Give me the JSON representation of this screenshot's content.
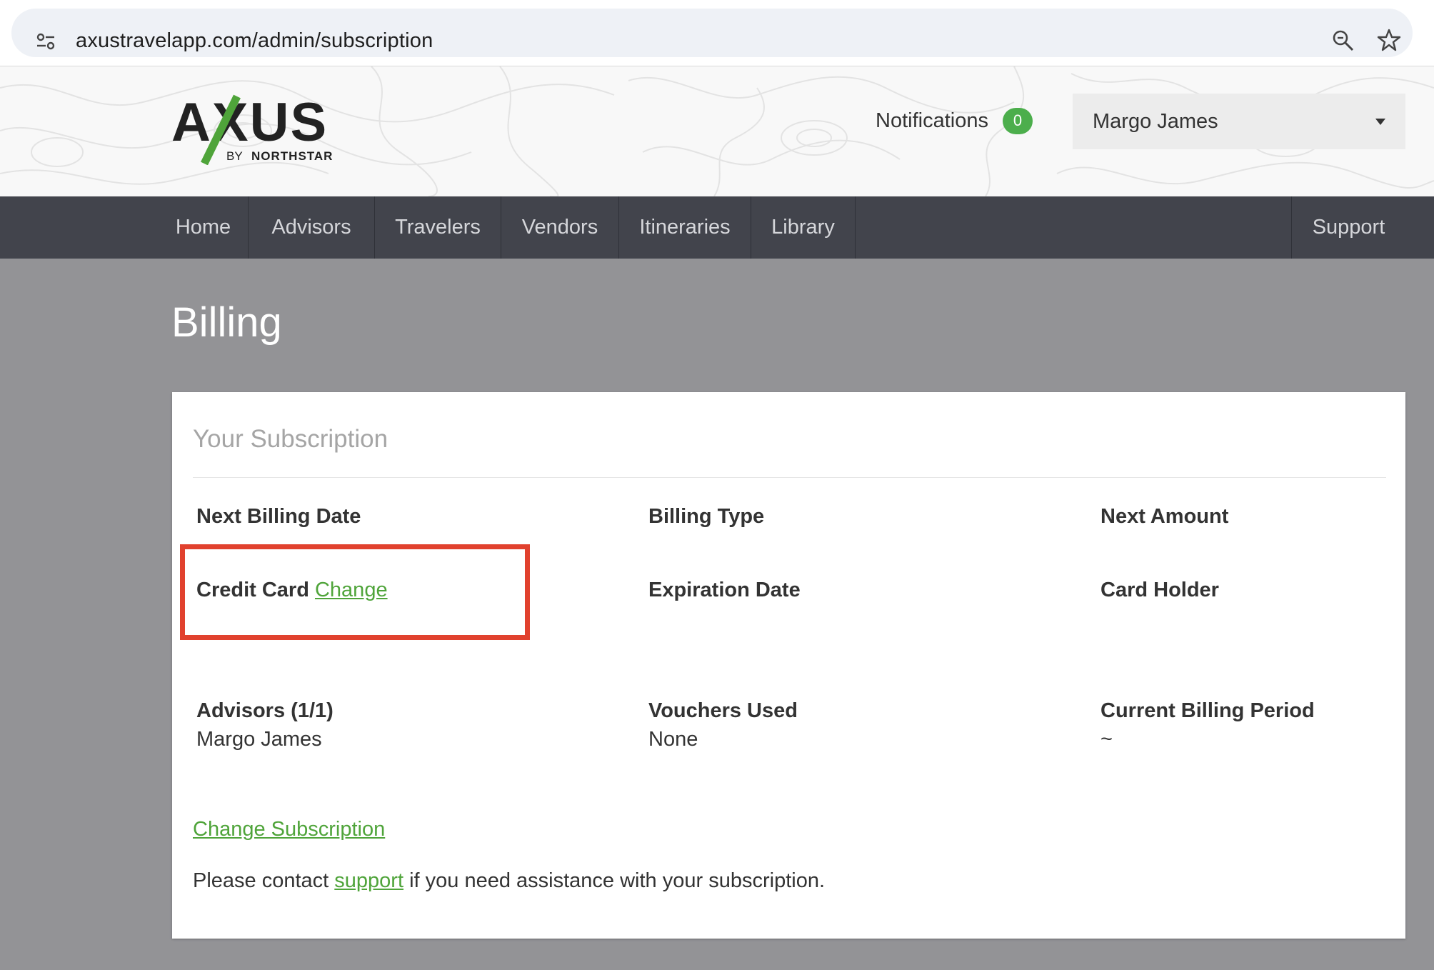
{
  "browser": {
    "url": "axustravelapp.com/admin/subscription"
  },
  "header": {
    "logo_text": "AXUS",
    "logo_sub_by": "BY",
    "logo_sub_brand": "NORTHSTAR",
    "notifications_label": "Notifications",
    "notifications_count": "0",
    "user_name": "Margo James"
  },
  "nav": {
    "items": [
      {
        "label": "Home"
      },
      {
        "label": "Advisors"
      },
      {
        "label": "Travelers"
      },
      {
        "label": "Vendors"
      },
      {
        "label": "Itineraries"
      },
      {
        "label": "Library"
      }
    ],
    "support_label": "Support"
  },
  "page": {
    "title": "Billing"
  },
  "subscription": {
    "card_title": "Your Subscription",
    "next_billing_date_label": "Next Billing Date",
    "billing_type_label": "Billing Type",
    "next_amount_label": "Next Amount",
    "credit_card_label": "Credit Card",
    "credit_card_change_link": "Change",
    "expiration_date_label": "Expiration Date",
    "card_holder_label": "Card Holder",
    "advisors_label": "Advisors (1/1)",
    "advisors_value": "Margo James",
    "vouchers_label": "Vouchers Used",
    "vouchers_value": "None",
    "billing_period_label": "Current Billing Period",
    "billing_period_value": "~",
    "change_subscription_link": "Change Subscription",
    "contact_prefix": "Please contact",
    "contact_link": "support",
    "contact_suffix": "if you need assistance with your subscription."
  },
  "colors": {
    "accent_green": "#4fa43a",
    "nav_bg": "#42444c",
    "page_bg": "#939396",
    "highlight_red": "#e1412e"
  }
}
